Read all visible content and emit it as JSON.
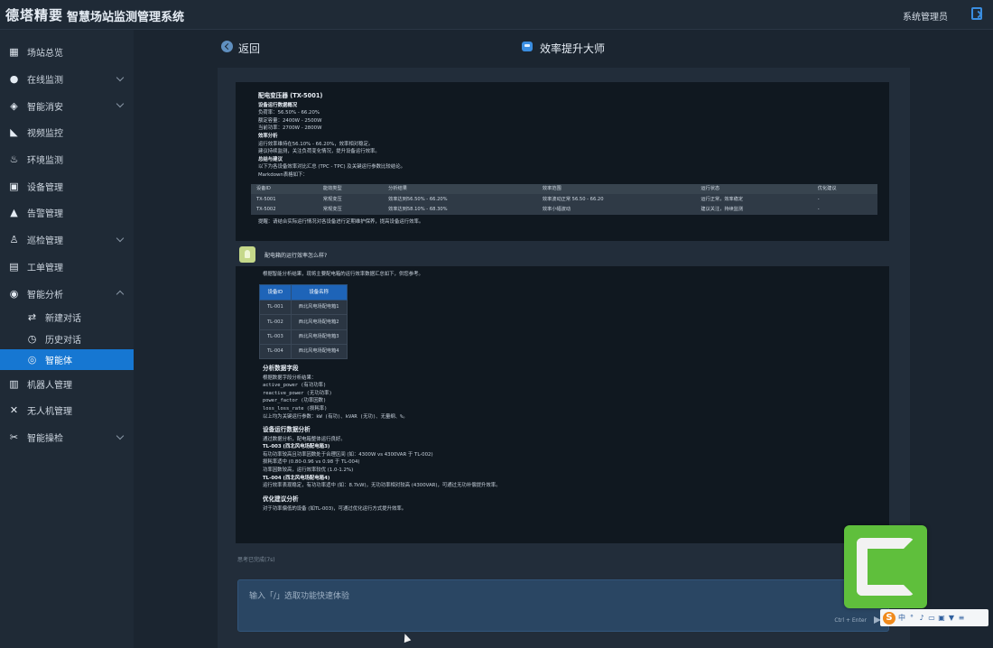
{
  "header": {
    "logo": "德塔精要",
    "system_name": "智慧场站监测管理系统",
    "user": "系统管理员"
  },
  "sidebar": {
    "items": [
      {
        "label": "场站总览",
        "icon": "grid-icon",
        "expandable": false
      },
      {
        "label": "在线监测",
        "icon": "monitor-icon",
        "expandable": true
      },
      {
        "label": "智能消安",
        "icon": "shield-icon",
        "expandable": true
      },
      {
        "label": "视频监控",
        "icon": "camera-icon",
        "expandable": false
      },
      {
        "label": "环境监测",
        "icon": "environment-icon",
        "expandable": false
      },
      {
        "label": "设备管理",
        "icon": "device-icon",
        "expandable": false
      },
      {
        "label": "告警管理",
        "icon": "warning-icon",
        "expandable": false
      },
      {
        "label": "巡检管理",
        "icon": "patrol-icon",
        "expandable": true
      },
      {
        "label": "工单管理",
        "icon": "ticket-icon",
        "expandable": false
      },
      {
        "label": "智能分析",
        "icon": "analysis-icon",
        "expandable": true,
        "open": true
      }
    ],
    "sub_items": [
      {
        "label": "新建对话",
        "icon": "new-chat-icon"
      },
      {
        "label": "历史对话",
        "icon": "history-icon"
      },
      {
        "label": "智能体",
        "icon": "agent-icon",
        "active": true
      }
    ],
    "items_after": [
      {
        "label": "机器人管理",
        "icon": "robot-icon",
        "expandable": false
      },
      {
        "label": "无人机管理",
        "icon": "drone-icon",
        "expandable": false
      },
      {
        "label": "智能操检",
        "icon": "tools-icon",
        "expandable": true
      }
    ]
  },
  "main": {
    "back_label": "返回",
    "title": "效率提升大师",
    "accent": "#1677d2"
  },
  "message_1": {
    "heading": "配电变压器 (TX-5001)",
    "section1": "设备运行数据概况",
    "lines1": [
      "负荷率：56.50% - 66.20%",
      "额定容量：2400W - 2500W",
      "当前功率：2700W - 2800W"
    ],
    "section2": "效率分析",
    "lines2": [
      "运行效率维持在56.10% - 66.20%，效率相对稳定。",
      "建议持续监测，关注负荷变化情况，提升设备运行效率。"
    ],
    "section3": "总结与建议",
    "lines3": [
      "以下为各设备效率对比汇总 (TPC - TPC) 及关键运行参数比较结论。",
      "Markdown表格如下："
    ],
    "table_headers": [
      "设备ID",
      "能效类型",
      "分析结果",
      "效率范围",
      "运行状态",
      "优化建议"
    ],
    "table_rows": [
      [
        "TX-5001",
        "常规变压",
        "效率达到56.50% - 66.20%",
        "效率波动正常 56.50 - 66.20",
        "运行正常，效率稳定",
        "-"
      ],
      [
        "TX-5002",
        "常规变压",
        "效率达到58.10% - 68.30%",
        "效率小幅波动",
        "建议关注，持续监测",
        "-"
      ]
    ],
    "footer": "提醒：请结合实际运行情况对各设备进行定期维护保养，提高设备运行效率。"
  },
  "user_question": "配电箱的运行效率怎么样?",
  "message_2": {
    "intro": "根据智能分析结果，现将主要配电箱的运行效率数据汇总如下，供您参考。",
    "table_headers": [
      "设备ID",
      "设备名称"
    ],
    "table_rows": [
      [
        "TL-001",
        "西北风电场配电箱1"
      ],
      [
        "TL-002",
        "西北风电场配电箱2"
      ],
      [
        "TL-003",
        "西北风电场配电箱3"
      ],
      [
        "TL-004",
        "西北风电场配电箱4"
      ]
    ],
    "section1": "分析数据字段",
    "fields": [
      "根据数据字段分析结果：",
      "active_power (有功功率)",
      "reactive_power (无功功率)",
      "power_factor (功率因数)",
      "loss_loss_rate (损耗率)",
      "以上均为关键运行参数：kW (有功)、kVAR (无功)、无量纲、%。"
    ],
    "section2": "设备运行数据分析",
    "analysis": [
      "通过数据分析，配电箱整体运行良好。",
      "TL-003 (西北风电场配电箱3)",
      "有功功率较高且功率因数处于合理区间 (如：4300W vs 4300VAR 于 TL-002)",
      "损耗率适中 (0.80-0.96 vs 0.98 于 TL-004)",
      "功率因数较高，运行效率较优 (1.0-1.2%)",
      "TL-004 (西北风电场配电箱4)",
      "运行效率表现稳定，有功功率适中 (如：8.7kW)，无功功率相对较高 (4300VAR)，可通过无功补偿提升效率。"
    ],
    "section3": "优化建议分析",
    "last_line": "对于功率偏低的设备 (如TL-003)，可通过优化运行方式提升效率。"
  },
  "thinking": "思考已完成(7s)",
  "input": {
    "placeholder": "输入「/」选取功能快速体验",
    "hint": "Ctrl + Enter"
  },
  "overlay": {
    "ime_letter": "S"
  }
}
